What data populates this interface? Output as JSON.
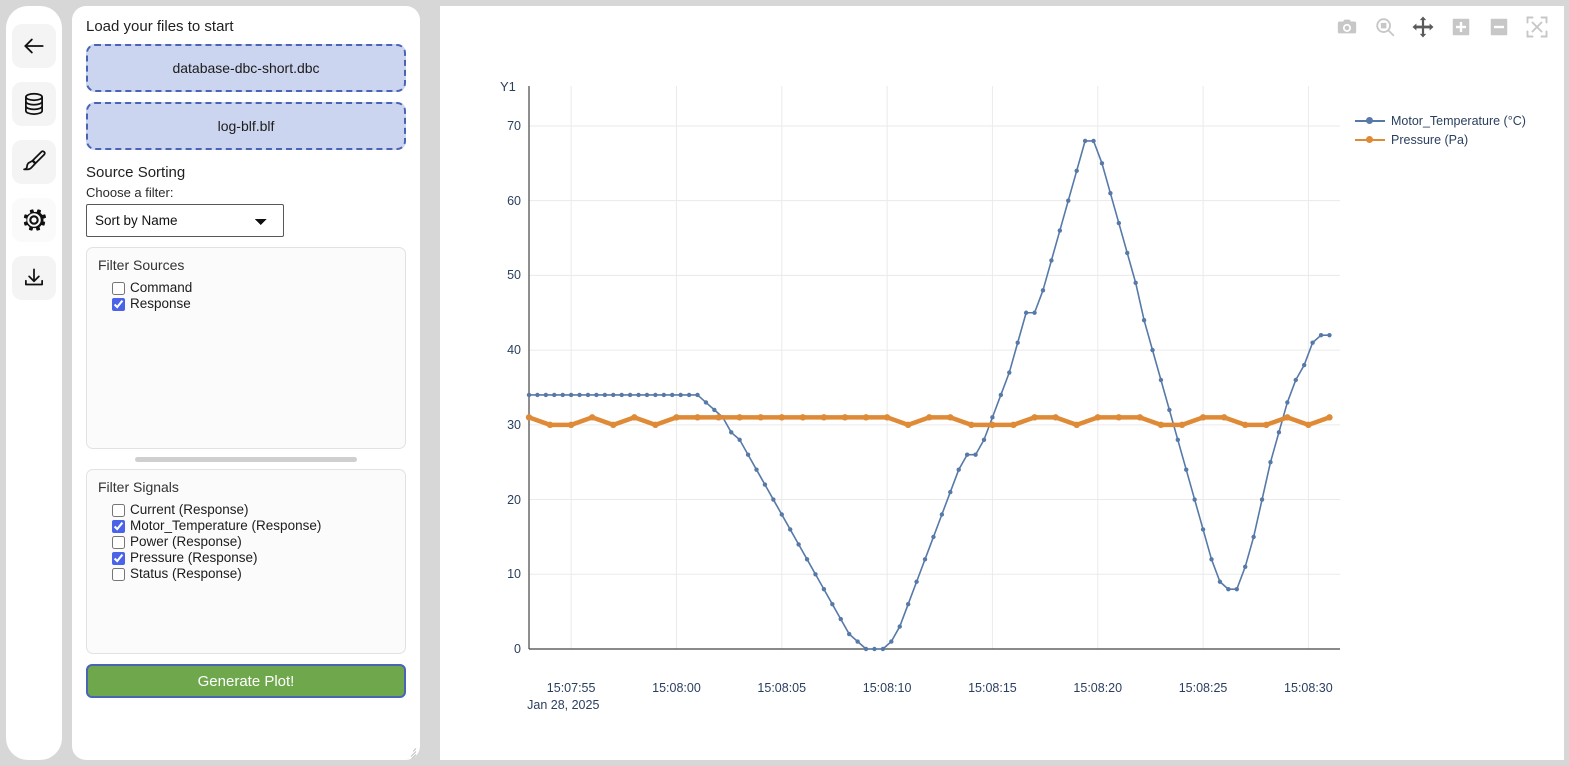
{
  "rail": {
    "items": [
      {
        "icon": "back-arrow-icon",
        "name": "back-button"
      },
      {
        "icon": "database-icon",
        "name": "database-button"
      },
      {
        "icon": "paintbrush-icon",
        "name": "theme-button"
      },
      {
        "icon": "gear-icon",
        "name": "settings-button"
      },
      {
        "icon": "download-icon",
        "name": "download-button"
      }
    ]
  },
  "panel": {
    "title": "Load your files to start",
    "uploads": [
      {
        "label": "database-dbc-short.dbc"
      },
      {
        "label": "log-blf.blf"
      }
    ],
    "source_sorting_heading": "Source Sorting",
    "filter_label": "Choose a filter:",
    "filter_selected": "Sort by Name",
    "filter_options": [
      "Sort by Name"
    ],
    "sources": {
      "title": "Filter Sources",
      "items": [
        {
          "label": "Command",
          "checked": false
        },
        {
          "label": "Response",
          "checked": true
        }
      ]
    },
    "signals": {
      "title": "Filter Signals",
      "items": [
        {
          "label": "Current (Response)",
          "checked": false
        },
        {
          "label": "Motor_Temperature (Response)",
          "checked": true
        },
        {
          "label": "Power (Response)",
          "checked": false
        },
        {
          "label": "Pressure (Response)",
          "checked": true
        },
        {
          "label": "Status (Response)",
          "checked": false
        }
      ]
    },
    "generate_label": "Generate Plot!"
  },
  "modebar": {
    "buttons": [
      {
        "name": "camera-icon",
        "title": "Download plot as a png"
      },
      {
        "name": "zoom-box-icon",
        "title": "Zoom"
      },
      {
        "name": "pan-icon",
        "title": "Pan"
      },
      {
        "name": "zoom-in-icon",
        "title": "Zoom in"
      },
      {
        "name": "zoom-out-icon",
        "title": "Zoom out"
      },
      {
        "name": "autoscale-icon",
        "title": "Autoscale"
      }
    ]
  },
  "chart_data": {
    "type": "line",
    "title": "",
    "xlabel": "",
    "ylabel": "Y1",
    "y_axis_title": "Y1",
    "grid": true,
    "legend_position": "right",
    "ylim": [
      0,
      72
    ],
    "yticks": [
      0,
      10,
      20,
      30,
      40,
      50,
      60,
      70
    ],
    "xticks": [
      "15:07:55",
      "15:08:00",
      "15:08:05",
      "15:08:10",
      "15:08:15",
      "15:08:20",
      "15:08:25",
      "15:08:30"
    ],
    "x_date_label": "Jan 28, 2025",
    "xlim": [
      "15:07:53.0",
      "15:08:31.0"
    ],
    "colors": {
      "motor_temperature": "#5779a8",
      "pressure": "#de8a36"
    },
    "series": [
      {
        "name": "Motor_Temperature (°C)",
        "unit": "°C",
        "color": "#5779a8",
        "x": [
          53.0,
          53.4,
          53.8,
          54.2,
          54.6,
          55.0,
          55.4,
          55.8,
          56.2,
          56.6,
          57.0,
          57.4,
          57.8,
          58.2,
          58.6,
          59.0,
          59.4,
          59.8,
          60.2,
          60.6,
          61.0,
          61.4,
          61.8,
          62.2,
          62.6,
          63.0,
          63.4,
          63.8,
          64.2,
          64.6,
          65.0,
          65.4,
          65.8,
          66.2,
          66.6,
          67.0,
          67.4,
          67.8,
          68.2,
          68.6,
          69.0,
          69.4,
          69.8,
          70.2,
          70.6,
          71.0,
          71.4,
          71.8,
          72.2,
          72.6,
          73.0,
          73.4,
          73.8,
          74.2,
          74.6,
          75.0,
          75.4,
          75.8,
          76.2,
          76.6,
          77.0,
          77.4,
          77.8,
          78.2,
          78.6,
          79.0,
          79.4,
          79.8,
          80.2,
          80.6,
          81.0,
          81.4,
          81.8,
          82.2,
          82.6,
          83.0,
          83.4,
          83.8,
          84.2,
          84.6,
          85.0,
          85.4,
          85.8,
          86.2,
          86.6,
          87.0,
          87.4,
          87.8,
          88.2,
          88.6,
          89.0,
          89.4,
          89.8,
          90.2,
          90.6,
          91.0
        ],
        "y": [
          34,
          34,
          34,
          34,
          34,
          34,
          34,
          34,
          34,
          34,
          34,
          34,
          34,
          34,
          34,
          34,
          34,
          34,
          34,
          34,
          34,
          33,
          32,
          31,
          29,
          28,
          26,
          24,
          22,
          20,
          18,
          16,
          14,
          12,
          10,
          8,
          6,
          4,
          2,
          1,
          0,
          0,
          0,
          1,
          3,
          6,
          9,
          12,
          15,
          18,
          21,
          24,
          26,
          26,
          28,
          31,
          34,
          37,
          41,
          45,
          45,
          48,
          52,
          56,
          60,
          64,
          68,
          68,
          65,
          61,
          57,
          53,
          49,
          44,
          40,
          36,
          32,
          28,
          24,
          20,
          16,
          12,
          9,
          8,
          8,
          11,
          15,
          20,
          25,
          29,
          33,
          36,
          38,
          41,
          42,
          42
        ],
        "final_flat_value": 42,
        "initial_flat_value": 34,
        "min": 0,
        "max": 68
      },
      {
        "name": "Pressure (Pa)",
        "unit": "Pa",
        "color": "#de8a36",
        "baseline": 31,
        "dip_value": 30,
        "x": [
          53.0,
          54.0,
          55.0,
          56.0,
          57.0,
          58.0,
          59.0,
          60.0,
          61.0,
          62.0,
          63.0,
          64.0,
          65.0,
          66.0,
          67.0,
          68.0,
          69.0,
          70.0,
          71.0,
          72.0,
          73.0,
          74.0,
          75.0,
          76.0,
          77.0,
          78.0,
          79.0,
          80.0,
          81.0,
          82.0,
          83.0,
          84.0,
          85.0,
          86.0,
          87.0,
          88.0,
          89.0,
          90.0,
          91.0
        ],
        "y": [
          31,
          30,
          30,
          31,
          30,
          31,
          30,
          31,
          31,
          31,
          31,
          31,
          31,
          31,
          31,
          31,
          31,
          31,
          30,
          31,
          31,
          30,
          30,
          30,
          31,
          31,
          30,
          31,
          31,
          31,
          30,
          30,
          31,
          31,
          30,
          30,
          31,
          30,
          31
        ],
        "min": 30,
        "max": 31
      }
    ]
  }
}
